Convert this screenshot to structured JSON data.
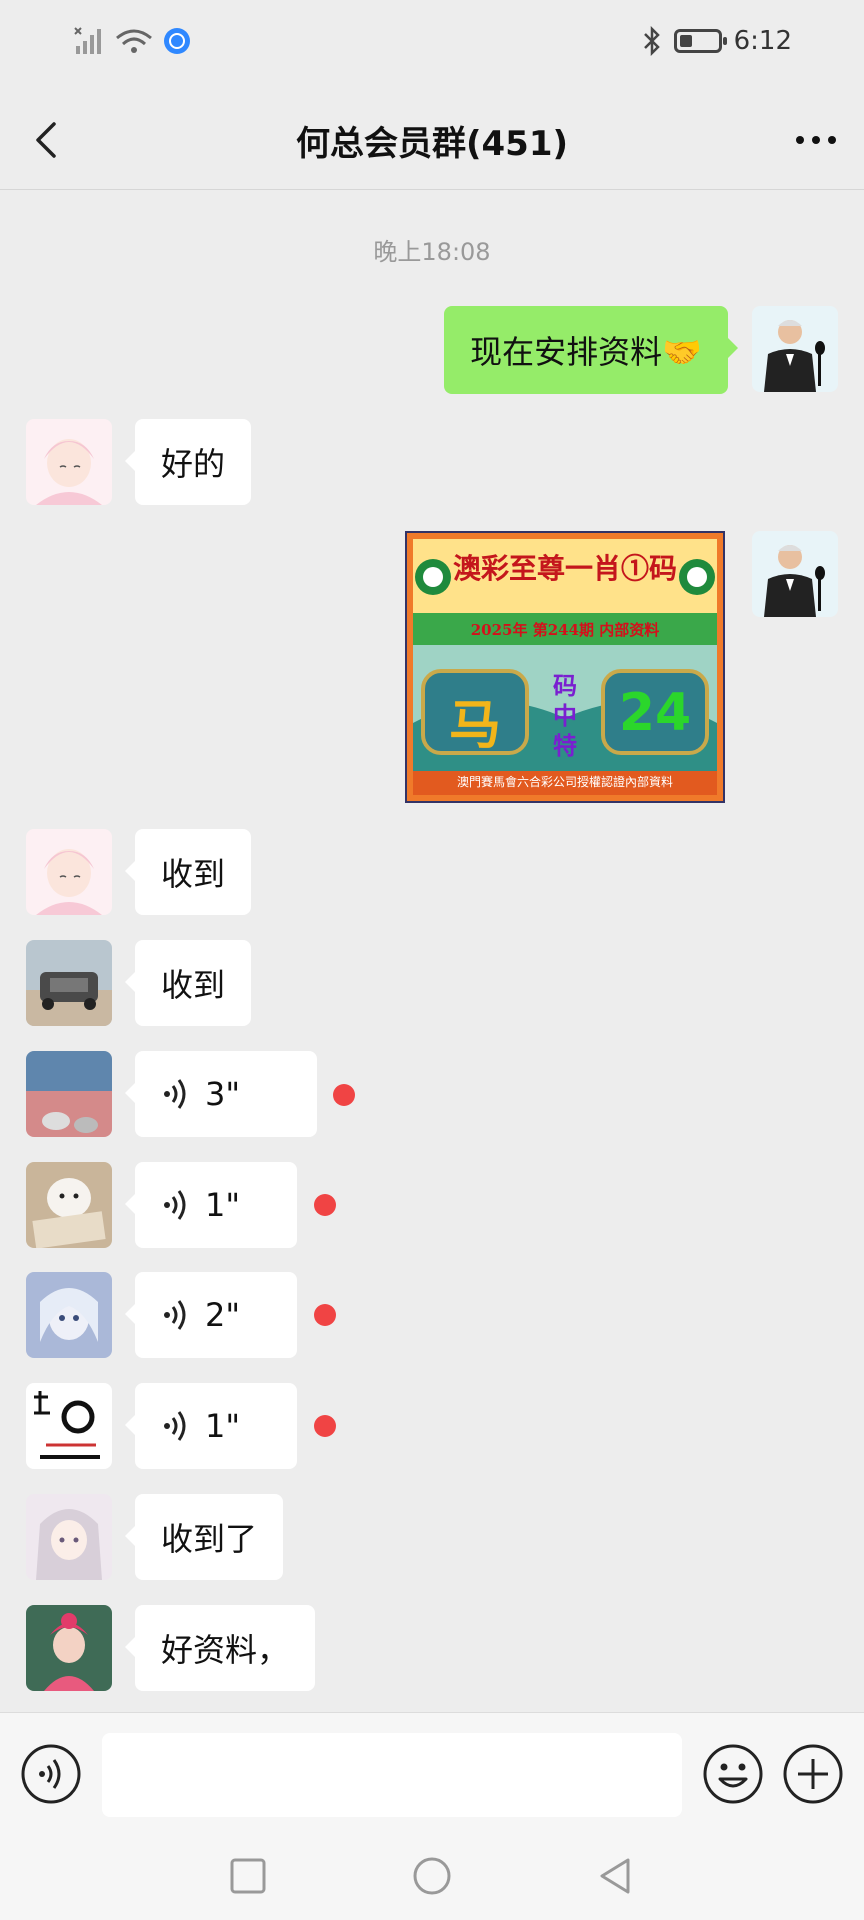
{
  "status_bar": {
    "time": "6:12",
    "icons": [
      "signal-icon",
      "wifi-icon",
      "app-notification-icon",
      "bluetooth-icon",
      "battery-icon"
    ]
  },
  "header": {
    "back_icon": "back-chevron-icon",
    "title": "何总会员群(451)",
    "more_icon": "more-dots-icon"
  },
  "chat": {
    "timestamp": "晚上18:08",
    "messages": [
      {
        "direction": "out",
        "type": "text",
        "text": "现在安排资料🤝"
      },
      {
        "direction": "in",
        "type": "text",
        "text": "好的"
      },
      {
        "direction": "out",
        "type": "image",
        "image_text": {
          "title": "澳彩至尊一肖①码",
          "banner": "2025年 第244期 内部资料",
          "left_value": "马",
          "center_value": "码中特",
          "right_value": "24",
          "footer": "澳門賽馬會六合彩公司授權認證內部資料"
        }
      },
      {
        "direction": "in",
        "type": "text",
        "text": "收到"
      },
      {
        "direction": "in",
        "type": "text",
        "text": "收到"
      },
      {
        "direction": "in",
        "type": "voice",
        "duration": "3\"",
        "unread": true
      },
      {
        "direction": "in",
        "type": "voice",
        "duration": "1\"",
        "unread": true
      },
      {
        "direction": "in",
        "type": "voice",
        "duration": "2\"",
        "unread": true
      },
      {
        "direction": "in",
        "type": "voice",
        "duration": "1\"",
        "unread": true
      },
      {
        "direction": "in",
        "type": "text",
        "text": "收到了"
      },
      {
        "direction": "in",
        "type": "text",
        "text": "好资料，"
      }
    ]
  },
  "input_bar": {
    "voice_icon": "voice-input-icon",
    "text_value": "",
    "emoji_icon": "emoji-icon",
    "plus_icon": "plus-icon"
  },
  "system_nav": {
    "icons": [
      "recents-square-icon",
      "home-circle-icon",
      "back-triangle-icon"
    ]
  },
  "colors": {
    "background": "#ededed",
    "bubble_out": "#95ec69",
    "bubble_in": "#ffffff",
    "unread_dot": "#f04444"
  }
}
